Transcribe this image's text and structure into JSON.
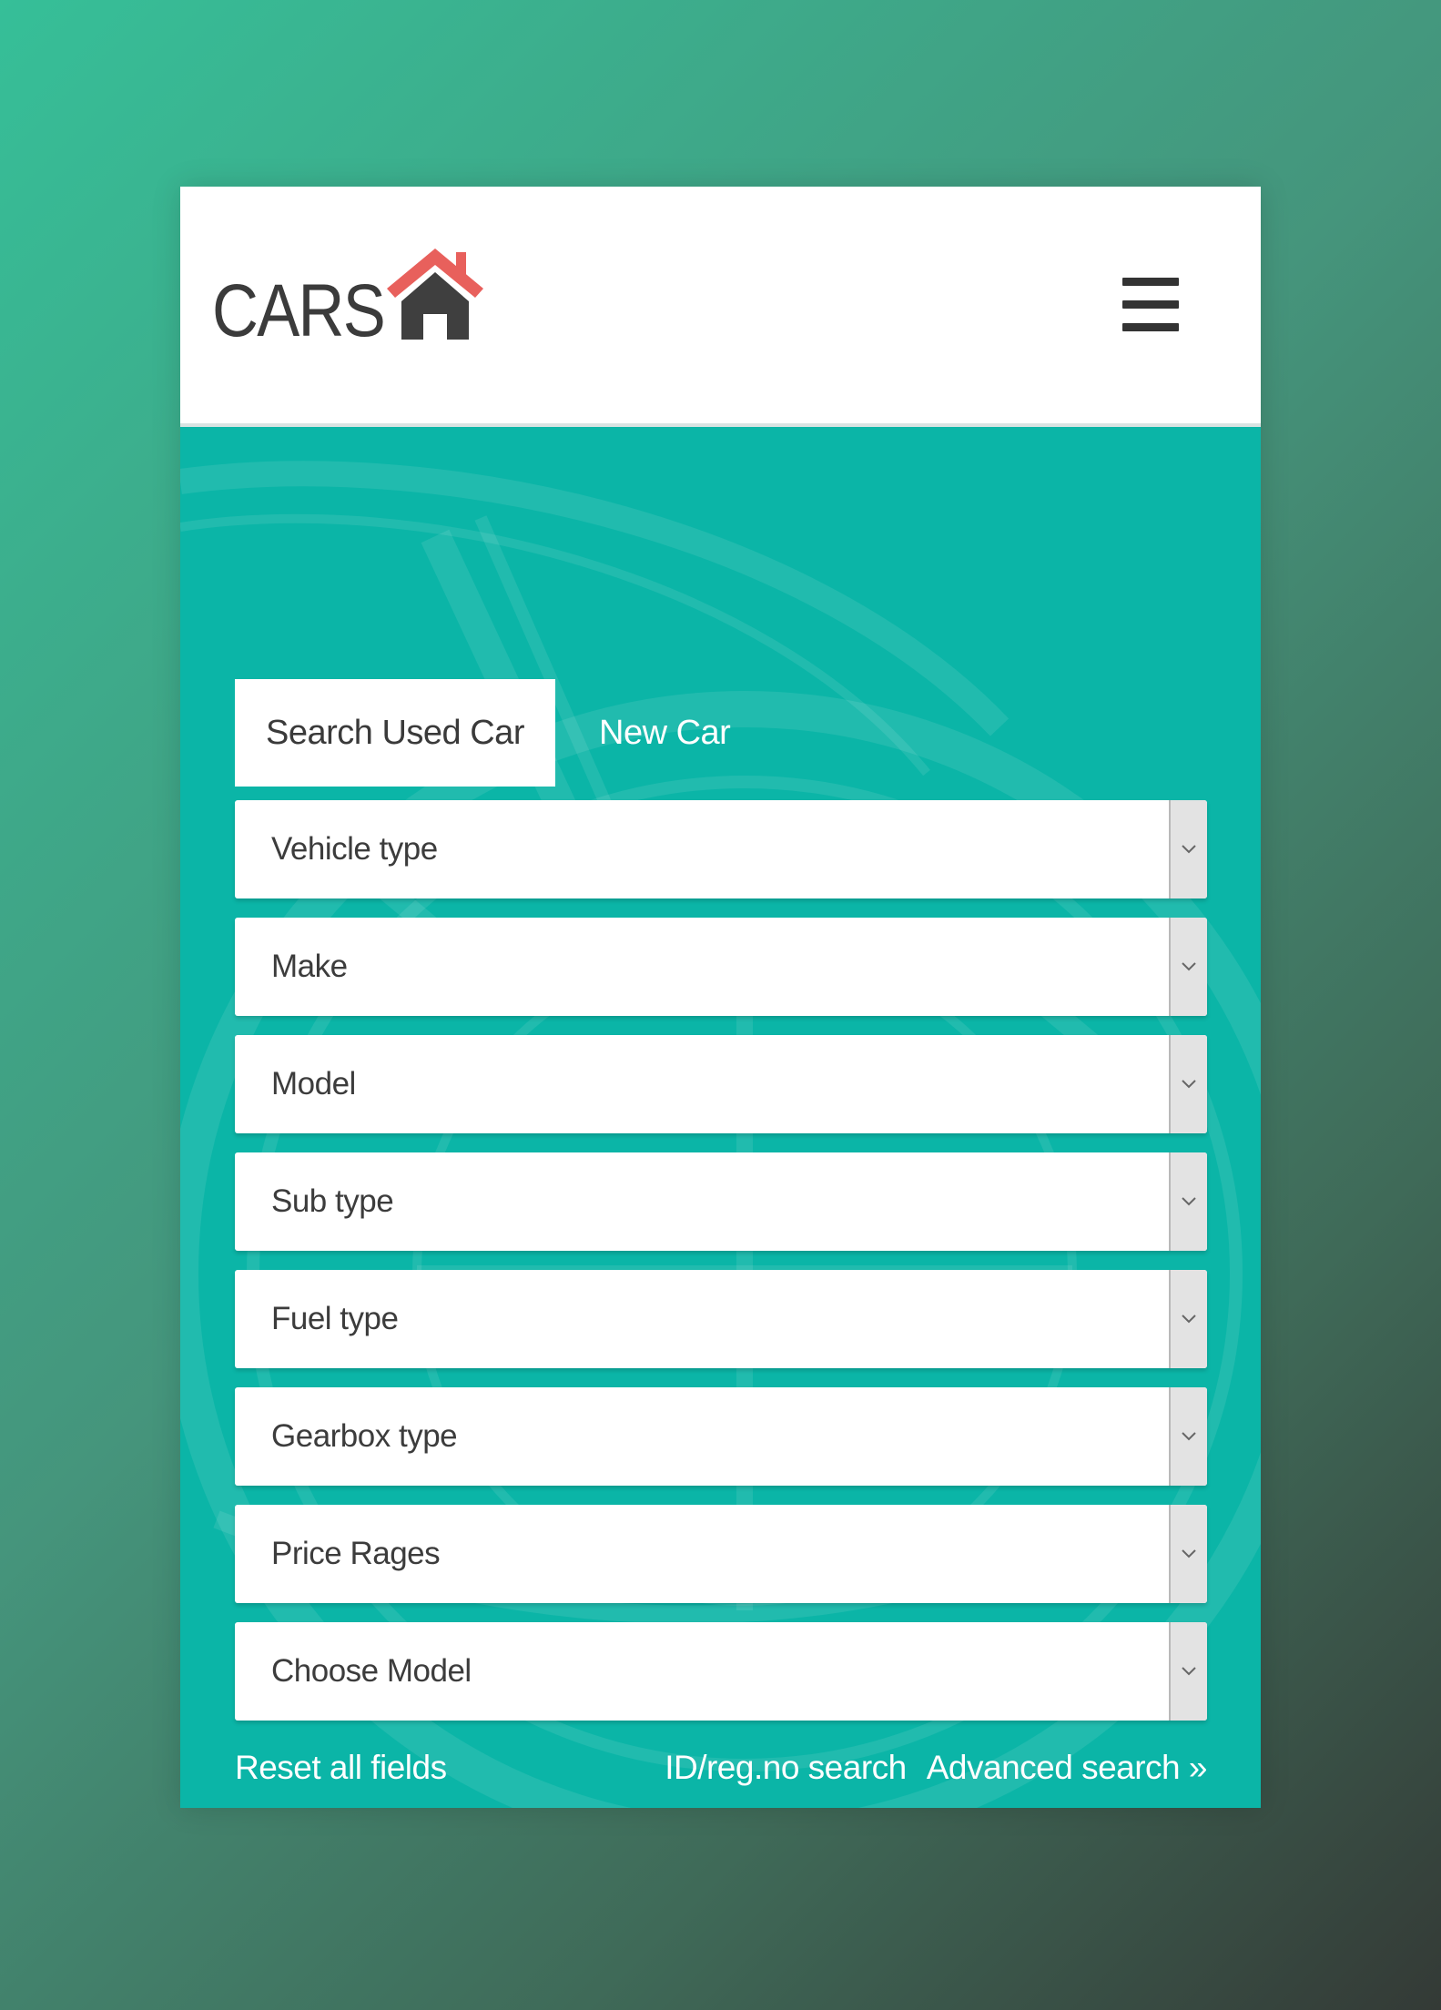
{
  "header": {
    "logo_text": "CARS",
    "logo_icon": "house-icon",
    "menu_icon": "hamburger-menu-icon"
  },
  "tabs": [
    {
      "label": "Search Used Car",
      "active": true
    },
    {
      "label": "New Car",
      "active": false
    }
  ],
  "selects": [
    {
      "label": "Vehicle type"
    },
    {
      "label": "Make"
    },
    {
      "label": "Model"
    },
    {
      "label": "Sub type"
    },
    {
      "label": "Fuel type"
    },
    {
      "label": "Gearbox type"
    },
    {
      "label": "Price Rages"
    },
    {
      "label": "Choose Model"
    }
  ],
  "links": {
    "reset": "Reset all fields",
    "id_search": "ID/reg.no search",
    "advanced": "Advanced search »"
  },
  "colors": {
    "accent": "#0bb5a7",
    "logo_roof": "#e8605c",
    "logo_text": "#3b3b3b"
  }
}
